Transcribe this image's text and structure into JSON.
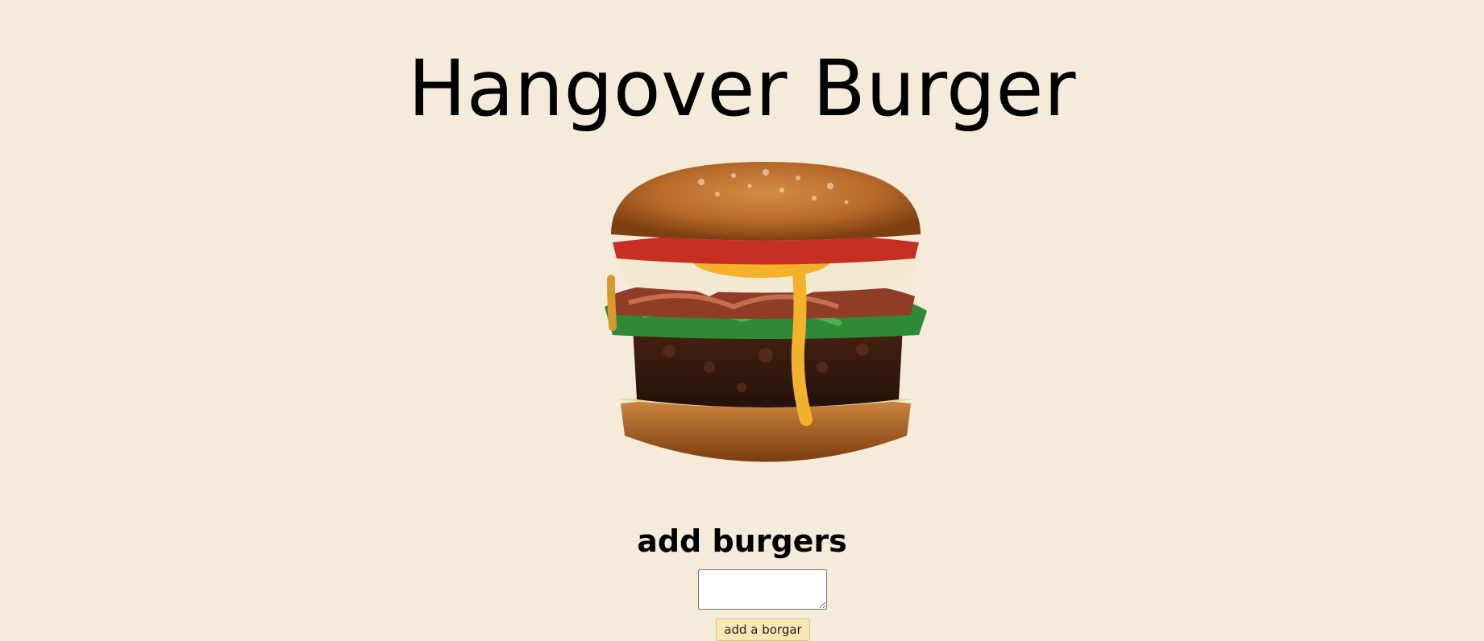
{
  "header": {
    "title": "Hangover Burger"
  },
  "hero": {
    "image_name": "burger-image"
  },
  "form": {
    "heading": "add burgers",
    "textarea_value": "",
    "button_label": "add a borgar"
  },
  "colors": {
    "background": "#f5ebda",
    "button_background": "#fbe7b6",
    "button_border": "#d8c08a"
  }
}
